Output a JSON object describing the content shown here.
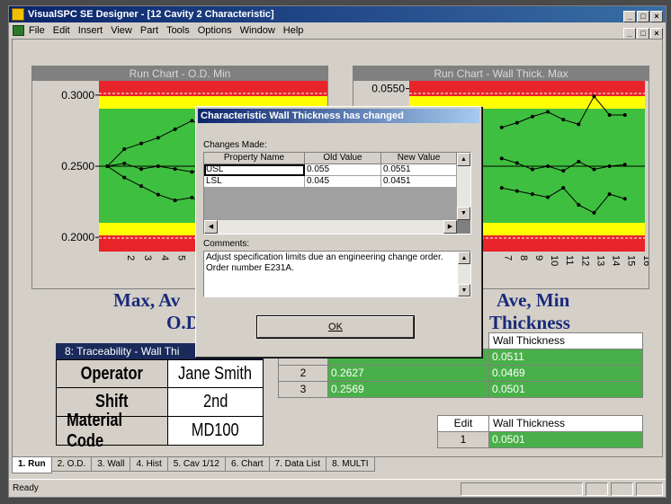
{
  "window": {
    "title": "VisualSPC SE Designer - [12 Cavity 2 Characteristic]",
    "controls": [
      "_",
      "□",
      "×"
    ]
  },
  "menu": {
    "items": [
      "File",
      "Edit",
      "Insert",
      "View",
      "Part",
      "Tools",
      "Options",
      "Window",
      "Help"
    ]
  },
  "chart_data": [
    {
      "type": "line",
      "title": "Run Chart - O.D. Min",
      "y_ticks": [
        "0.3000",
        "0.2500",
        "0.2000"
      ],
      "ylim": [
        0.19,
        0.31
      ],
      "x_ticks": [
        "2",
        "3",
        "4",
        "5",
        "6",
        "7",
        "8"
      ],
      "zones": {
        "red": "#e8232a",
        "yellow": "#ffff00",
        "green": "#3fbf3f"
      },
      "series": [
        {
          "x": [
            1,
            2,
            3,
            4,
            5,
            6,
            7,
            8
          ],
          "values": [
            0.25,
            0.262,
            0.266,
            0.27,
            0.276,
            0.282,
            0.276,
            0.285
          ]
        },
        {
          "x": [
            1,
            2,
            3,
            4,
            5,
            6,
            7,
            8
          ],
          "values": [
            0.25,
            0.252,
            0.248,
            0.25,
            0.248,
            0.246,
            0.248,
            0.25
          ]
        },
        {
          "x": [
            1,
            2,
            3,
            4,
            5,
            6,
            7,
            8
          ],
          "values": [
            0.25,
            0.242,
            0.236,
            0.23,
            0.226,
            0.228,
            0.222,
            0.226
          ]
        }
      ]
    },
    {
      "type": "line",
      "title": "Run Chart - Wall Thick. Max",
      "y_ticks": [
        "0.0550"
      ],
      "ylim": [
        0.0445,
        0.0555
      ],
      "x_ticks": [
        "7",
        "8",
        "9",
        "10",
        "11",
        "12",
        "13",
        "14",
        "15",
        "16"
      ],
      "zones": {
        "red": "#e8232a",
        "yellow": "#ffff00",
        "green": "#3fbf3f"
      },
      "series": [
        {
          "x": [
            7,
            8,
            9,
            10,
            11,
            12,
            13,
            14,
            15,
            16
          ],
          "values": [
            0.0525,
            0.0528,
            0.0532,
            0.0535,
            0.053,
            0.0527,
            0.0545,
            0.0533,
            0.0533,
            null
          ]
        },
        {
          "x": [
            7,
            8,
            9,
            10,
            11,
            12,
            13,
            14,
            15,
            16
          ],
          "values": [
            0.0505,
            0.0502,
            0.0498,
            0.05,
            0.0497,
            0.0503,
            0.0498,
            0.05,
            0.0501,
            null
          ]
        },
        {
          "x": [
            7,
            8,
            9,
            10,
            11,
            12,
            13,
            14,
            15,
            16
          ],
          "values": [
            0.0486,
            0.0484,
            0.0482,
            0.048,
            0.0486,
            0.0475,
            0.047,
            0.0482,
            0.0479,
            null
          ]
        }
      ]
    }
  ],
  "left_title": {
    "line1": "Max, Av",
    "line2": "O.D"
  },
  "right_title": {
    "line1": "Ave, Min",
    "line2": "Thickness"
  },
  "traceability": {
    "header": "8: Traceability - Wall Thi",
    "rows": [
      {
        "label": "Operator",
        "value": "Jane Smith"
      },
      {
        "label": "Shift",
        "value": "2nd"
      },
      {
        "label": "Material Code",
        "value": "MD100"
      }
    ]
  },
  "data_table": {
    "header_col2": "Wall Thickness",
    "rows": [
      {
        "num": "",
        "c1": "",
        "c2": "0.0511"
      },
      {
        "num": "2",
        "c1": "0.2627",
        "c2": "0.0469"
      },
      {
        "num": "3",
        "c1": "0.2569",
        "c2": "0.0501"
      }
    ]
  },
  "edit_table": {
    "edit_label": "Edit",
    "header": "Wall Thickness",
    "row_num": "1",
    "value": "0.0501"
  },
  "tabs": [
    {
      "label": "1. Run",
      "active": true
    },
    {
      "label": "2. O.D.",
      "active": false
    },
    {
      "label": "3. Wall",
      "active": false
    },
    {
      "label": "4. Hist",
      "active": false
    },
    {
      "label": "5. Cav 1/12",
      "active": false
    },
    {
      "label": "6. Chart",
      "active": false
    },
    {
      "label": "7. Data List",
      "active": false
    },
    {
      "label": "8. MULTI",
      "active": false
    }
  ],
  "status": {
    "text": "Ready"
  },
  "dialog": {
    "title": "Characteristic Wall Thickness has changed",
    "changes_label": "Changes Made:",
    "columns": [
      "Property Name",
      "Old Value",
      "New Value"
    ],
    "rows": [
      {
        "name": "USL",
        "old": "0.055",
        "new": "0.0551"
      },
      {
        "name": "LSL",
        "old": "0.045",
        "new": "0.0451"
      }
    ],
    "comments_label": "Comments:",
    "comments": "Adjust specification limits due an engineering change order.  Order number E231A.",
    "ok_label": "OK"
  }
}
